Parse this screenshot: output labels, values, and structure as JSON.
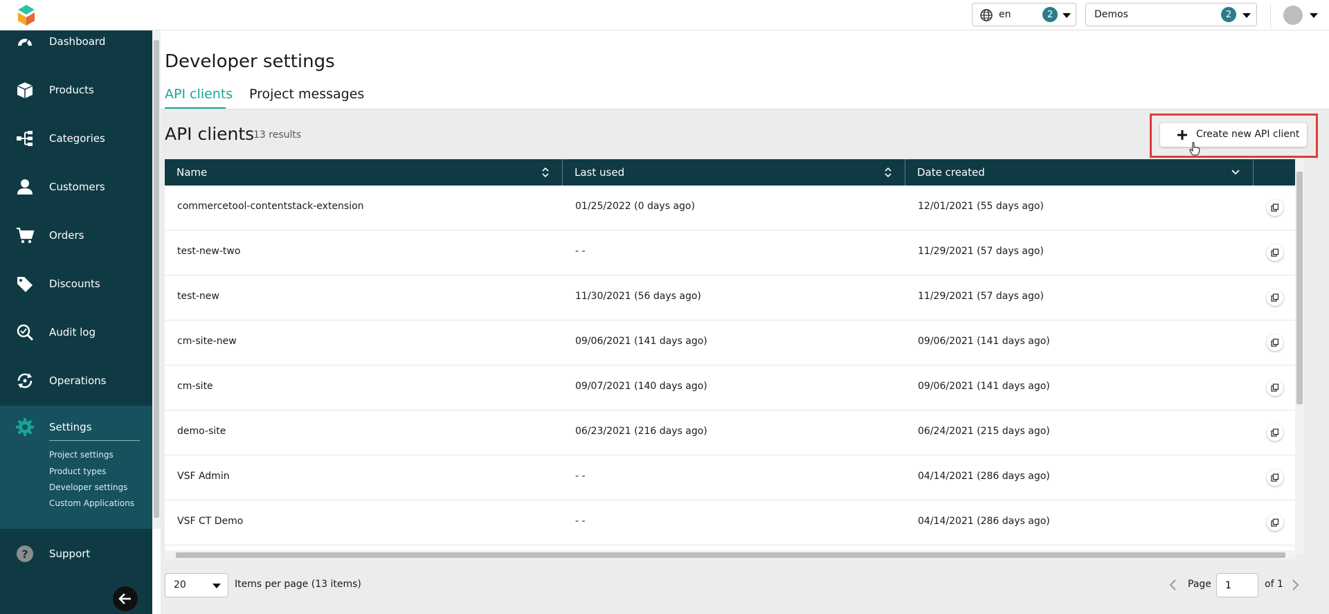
{
  "topbar": {
    "language": {
      "value": "en",
      "count": "2"
    },
    "project": {
      "value": "Demos",
      "count": "2"
    }
  },
  "sidebar": {
    "items": [
      {
        "label": "Dashboard",
        "icon": "dashboard-icon"
      },
      {
        "label": "Products",
        "icon": "box-icon"
      },
      {
        "label": "Categories",
        "icon": "tree-icon"
      },
      {
        "label": "Customers",
        "icon": "person-icon"
      },
      {
        "label": "Orders",
        "icon": "cart-icon"
      },
      {
        "label": "Discounts",
        "icon": "tag-icon"
      },
      {
        "label": "Audit log",
        "icon": "audit-icon"
      },
      {
        "label": "Operations",
        "icon": "operations-icon"
      }
    ],
    "settings": {
      "label": "Settings",
      "sub": [
        "Project settings",
        "Product types",
        "Developer settings",
        "Custom Applications"
      ]
    },
    "support": {
      "label": "Support"
    }
  },
  "page": {
    "title": "Developer settings",
    "tabs": [
      "API clients",
      "Project messages"
    ],
    "section_title": "API clients",
    "results": "13 results",
    "create_button": "Create new API client"
  },
  "table": {
    "columns": [
      "Name",
      "Last used",
      "Date created"
    ],
    "rows": [
      {
        "name": "commercetool-contentstack-extension",
        "last_used": "01/25/2022 (0 days ago)",
        "created": "12/01/2021 (55 days ago)"
      },
      {
        "name": "test-new-two",
        "last_used": "- -",
        "created": "11/29/2021 (57 days ago)"
      },
      {
        "name": "test-new",
        "last_used": "11/30/2021 (56 days ago)",
        "created": "11/29/2021 (57 days ago)"
      },
      {
        "name": "cm-site-new",
        "last_used": "09/06/2021 (141 days ago)",
        "created": "09/06/2021 (141 days ago)"
      },
      {
        "name": "cm-site",
        "last_used": "09/07/2021 (140 days ago)",
        "created": "09/06/2021 (141 days ago)"
      },
      {
        "name": "demo-site",
        "last_used": "06/23/2021 (216 days ago)",
        "created": "06/24/2021 (215 days ago)"
      },
      {
        "name": "VSF Admin",
        "last_used": "- -",
        "created": "04/14/2021 (286 days ago)"
      },
      {
        "name": "VSF CT Demo",
        "last_used": "- -",
        "created": "04/14/2021 (286 days ago)"
      }
    ]
  },
  "pagination": {
    "per_page": "20",
    "per_page_label": "Items per page (13 items)",
    "page_label": "Page",
    "page_value": "1",
    "of_label": "of 1"
  },
  "colors": {
    "sidebar": "#0f3a44",
    "accent": "#1aa39a",
    "badge": "#2a7d8a",
    "highlight": "#e03b3b"
  }
}
